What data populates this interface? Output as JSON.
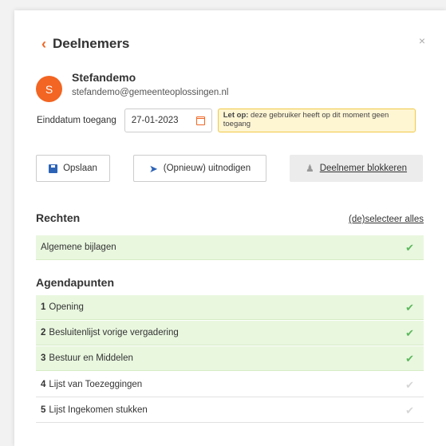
{
  "header": {
    "title": "Deelnemers",
    "close_label": "×"
  },
  "user": {
    "initial": "S",
    "name": "Stefandemo",
    "email": "stefandemo@gemeenteoplossingen.nl"
  },
  "access": {
    "end_date_label": "Einddatum toegang",
    "end_date_value": "27-01-2023",
    "warning_bold": "Let op:",
    "warning_text": " deze gebruiker heeft op dit moment geen toegang"
  },
  "actions": {
    "save_label": "Opslaan",
    "invite_label": "(Opnieuw) uitnodigen",
    "block_label": "Deelnemer blokkeren"
  },
  "rechten": {
    "title": "Rechten",
    "select_all_label": "(de)selecteer alles",
    "items": [
      {
        "label": "Algemene bijlagen",
        "checked": true
      }
    ]
  },
  "agenda": {
    "title": "Agendapunten",
    "items": [
      {
        "num": "1",
        "label": "Opening",
        "checked": true
      },
      {
        "num": "2",
        "label": "Besluitenlijst vorige vergadering",
        "checked": true
      },
      {
        "num": "3",
        "label": "Bestuur en Middelen",
        "checked": true
      },
      {
        "num": "4",
        "label": "Lijst van Toezeggingen",
        "checked": false
      },
      {
        "num": "5",
        "label": "Lijst Ingekomen stukken",
        "checked": false
      }
    ]
  },
  "colors": {
    "accent": "#f26522",
    "primary": "#2d63b7",
    "checked_bg": "#e9f7df",
    "check_on": "#5cb85c"
  }
}
